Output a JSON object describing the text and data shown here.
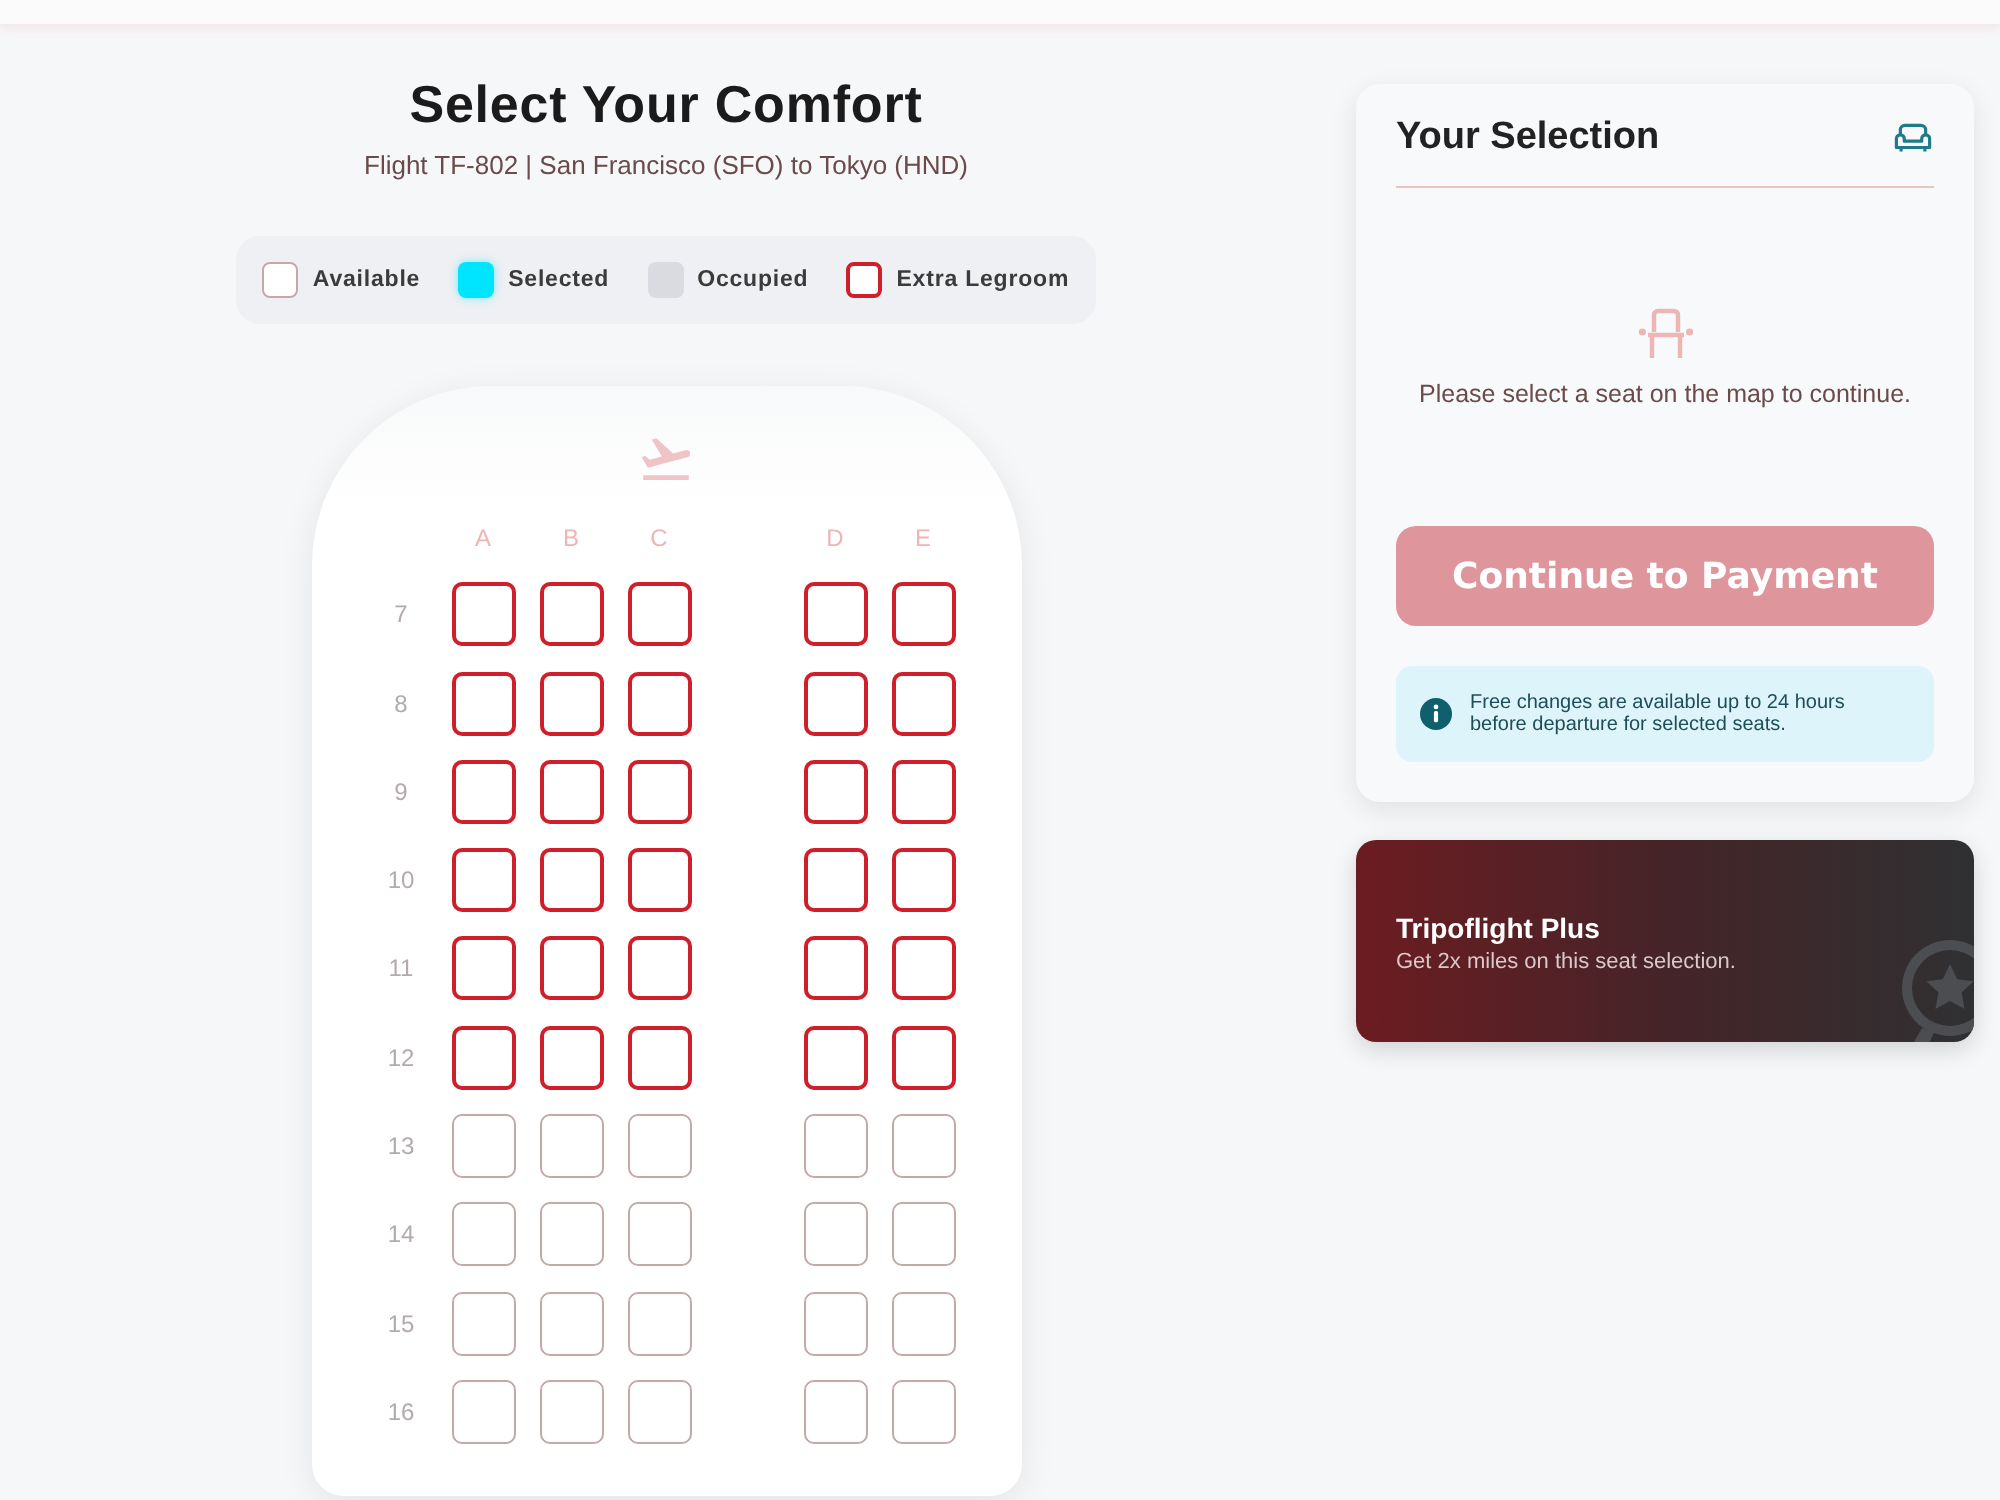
{
  "seat_map": {
    "title": "Select Your Comfort",
    "subtitle": "Flight TF-802 | San Francisco (SFO) to Tokyo (HND)",
    "legend": [
      {
        "label": "Available",
        "kind": "standard"
      },
      {
        "label": "Selected",
        "kind": "selected"
      },
      {
        "label": "Occupied",
        "kind": "occupied"
      },
      {
        "label": "Extra Legroom",
        "kind": "legroom"
      }
    ],
    "columns": [
      [
        "A",
        "B",
        "C"
      ],
      [
        "D",
        "E"
      ]
    ],
    "rows": [
      {
        "number": "7",
        "kind": "legroom",
        "seats": [
          [
            {
              "selected": false
            },
            {
              "selected": false
            },
            {
              "selected": false
            }
          ],
          [
            {
              "selected": false
            },
            {
              "selected": false
            }
          ]
        ]
      },
      {
        "number": "8",
        "kind": "legroom",
        "seats": [
          [
            {
              "selected": false
            },
            {
              "selected": false
            },
            {
              "selected": false
            }
          ],
          [
            {
              "selected": false
            },
            {
              "selected": false
            }
          ]
        ]
      },
      {
        "number": "9",
        "kind": "legroom",
        "seats": [
          [
            {
              "selected": false
            },
            {
              "selected": false
            },
            {
              "selected": false
            }
          ],
          [
            {
              "selected": false
            },
            {
              "selected": false
            }
          ]
        ]
      },
      {
        "number": "10",
        "kind": "legroom",
        "seats": [
          [
            {
              "selected": false
            },
            {
              "selected": false
            },
            {
              "selected": false
            }
          ],
          [
            {
              "selected": false
            },
            {
              "selected": false
            }
          ]
        ]
      },
      {
        "number": "11",
        "kind": "legroom",
        "seats": [
          [
            {
              "selected": false
            },
            {
              "selected": false
            },
            {
              "selected": false
            }
          ],
          [
            {
              "selected": false
            },
            {
              "selected": false
            }
          ]
        ]
      },
      {
        "number": "12",
        "kind": "legroom",
        "seats": [
          [
            {
              "selected": false
            },
            {
              "selected": false
            },
            {
              "selected": false
            }
          ],
          [
            {
              "selected": false
            },
            {
              "selected": false
            }
          ]
        ]
      },
      {
        "number": "13",
        "kind": "standard",
        "seats": [
          [
            {
              "selected": false
            },
            {
              "selected": false
            },
            {
              "selected": false
            }
          ],
          [
            {
              "selected": false
            },
            {
              "selected": false
            }
          ]
        ]
      },
      {
        "number": "14",
        "kind": "standard",
        "seats": [
          [
            {
              "selected": false
            },
            {
              "selected": false
            },
            {
              "selected": false
            }
          ],
          [
            {
              "selected": false
            },
            {
              "selected": false
            }
          ]
        ]
      },
      {
        "number": "15",
        "kind": "standard",
        "seats": [
          [
            {
              "selected": false
            },
            {
              "selected": false
            },
            {
              "selected": false
            }
          ],
          [
            {
              "selected": false
            },
            {
              "selected": false
            }
          ]
        ]
      },
      {
        "number": "16",
        "kind": "standard",
        "seats": [
          [
            {
              "selected": false
            },
            {
              "selected": false
            },
            {
              "selected": false
            }
          ],
          [
            {
              "selected": false
            },
            {
              "selected": false
            }
          ]
        ]
      }
    ]
  },
  "selection": {
    "title": "Your Selection",
    "empty_message": "Please select a seat on the map to continue.",
    "button": {
      "label": "Continue to Payment",
      "disabled": true
    },
    "note": "Free changes are available up to 24 hours before departure for selected seats."
  },
  "promo": {
    "title": "Tripoflight Plus",
    "text": "Get 2x miles on this seat selection."
  }
}
